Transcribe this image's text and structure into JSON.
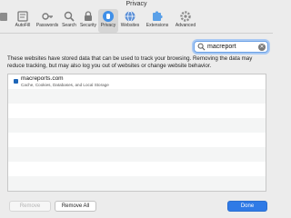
{
  "window": {
    "title": "Privacy"
  },
  "toolbar": {
    "items": [
      {
        "label": "",
        "icon": "partial-tab-icon"
      },
      {
        "label": "AutoFill",
        "icon": "autofill-icon"
      },
      {
        "label": "Passwords",
        "icon": "key-icon"
      },
      {
        "label": "Search",
        "icon": "search-icon"
      },
      {
        "label": "Security",
        "icon": "lock-icon"
      },
      {
        "label": "Privacy",
        "icon": "privacy-hand-icon",
        "active": true
      },
      {
        "label": "Websites",
        "icon": "globe-icon"
      },
      {
        "label": "Extensions",
        "icon": "puzzle-icon"
      },
      {
        "label": "Advanced",
        "icon": "gear-icon"
      }
    ]
  },
  "search": {
    "value": "macreport"
  },
  "description": "These websites have stored data that can be used to track your browsing. Removing the data may reduce tracking, but may also log you out of websites or change website behavior.",
  "list": {
    "rows": [
      {
        "site": "macreports.com",
        "details": "Cache, Cookies, Databases, and Local Storage"
      }
    ]
  },
  "buttons": {
    "remove": "Remove",
    "remove_all": "Remove All",
    "done": "Done"
  },
  "colors": {
    "accent": "#2f7ae6",
    "focus_ring": "#a9c9f3"
  }
}
